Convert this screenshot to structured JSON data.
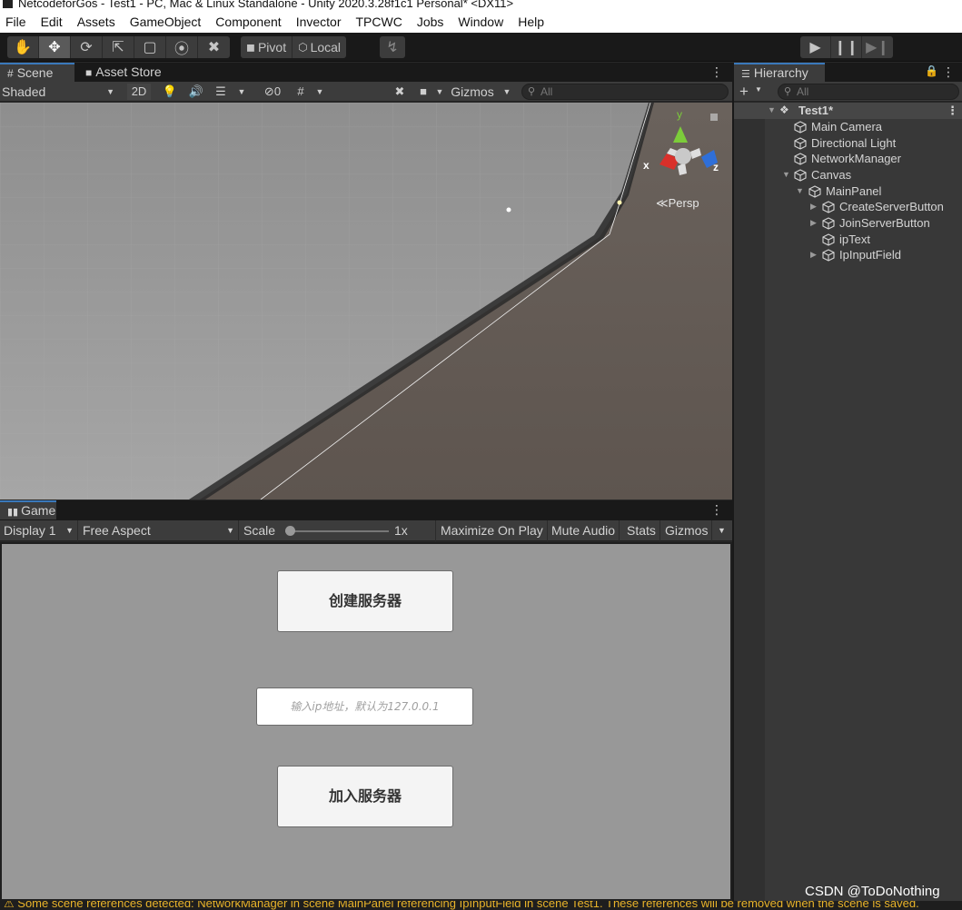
{
  "window": {
    "title": "NetcodeforGos - Test1 - PC, Mac & Linux Standalone - Unity 2020.3.28f1c1 Personal* <DX11>"
  },
  "menu": [
    "File",
    "Edit",
    "Assets",
    "GameObject",
    "Component",
    "Invector",
    "TPCWC",
    "Jobs",
    "Window",
    "Help"
  ],
  "toolbar": {
    "pivot_label": "Pivot",
    "local_label": "Local"
  },
  "scene_tabs": {
    "scene": "Scene",
    "asset_store": "Asset Store"
  },
  "scene_toolbar": {
    "draw_mode": "Shaded",
    "mode_2d": "2D",
    "hidden_count": "0",
    "gizmos": "Gizmos",
    "search_placeholder": "All"
  },
  "scene_view": {
    "projection_label": "Persp",
    "axis_x": "x",
    "axis_y": "y",
    "axis_z": "z"
  },
  "game_tab": {
    "label": "Game"
  },
  "game_toolbar": {
    "display": "Display 1",
    "aspect": "Free Aspect",
    "scale_label": "Scale",
    "scale_value": "1x",
    "scale_level": 0,
    "maximize": "Maximize On Play",
    "mute": "Mute Audio",
    "stats": "Stats",
    "gizmos": "Gizmos"
  },
  "game_ui": {
    "create_button": "创建服务器",
    "ip_placeholder": "输入ip地址，默认为127.0.0.1",
    "join_button": "加入服务器"
  },
  "hierarchy": {
    "tab_label": "Hierarchy",
    "search_placeholder": "All",
    "scene_name": "Test1*",
    "items": [
      {
        "label": "Main Camera"
      },
      {
        "label": "Directional Light"
      },
      {
        "label": "NetworkManager"
      },
      {
        "label": "Canvas"
      },
      {
        "label": "MainPanel"
      },
      {
        "label": "CreateServerButton"
      },
      {
        "label": "JoinServerButton"
      },
      {
        "label": "ipText"
      },
      {
        "label": "IpInputField"
      }
    ]
  },
  "status": {
    "message": "Some scene references detected: NetworkManager in scene MainPanel referencing IpInputField in scene Test1. These references will be removed when the scene is saved."
  },
  "watermark": "CSDN @ToDoNothing",
  "colors": {
    "accent": "#3a79bb",
    "warning": "#e8b32a",
    "panel": "#383838",
    "toolbar": "#3c3c3c"
  }
}
